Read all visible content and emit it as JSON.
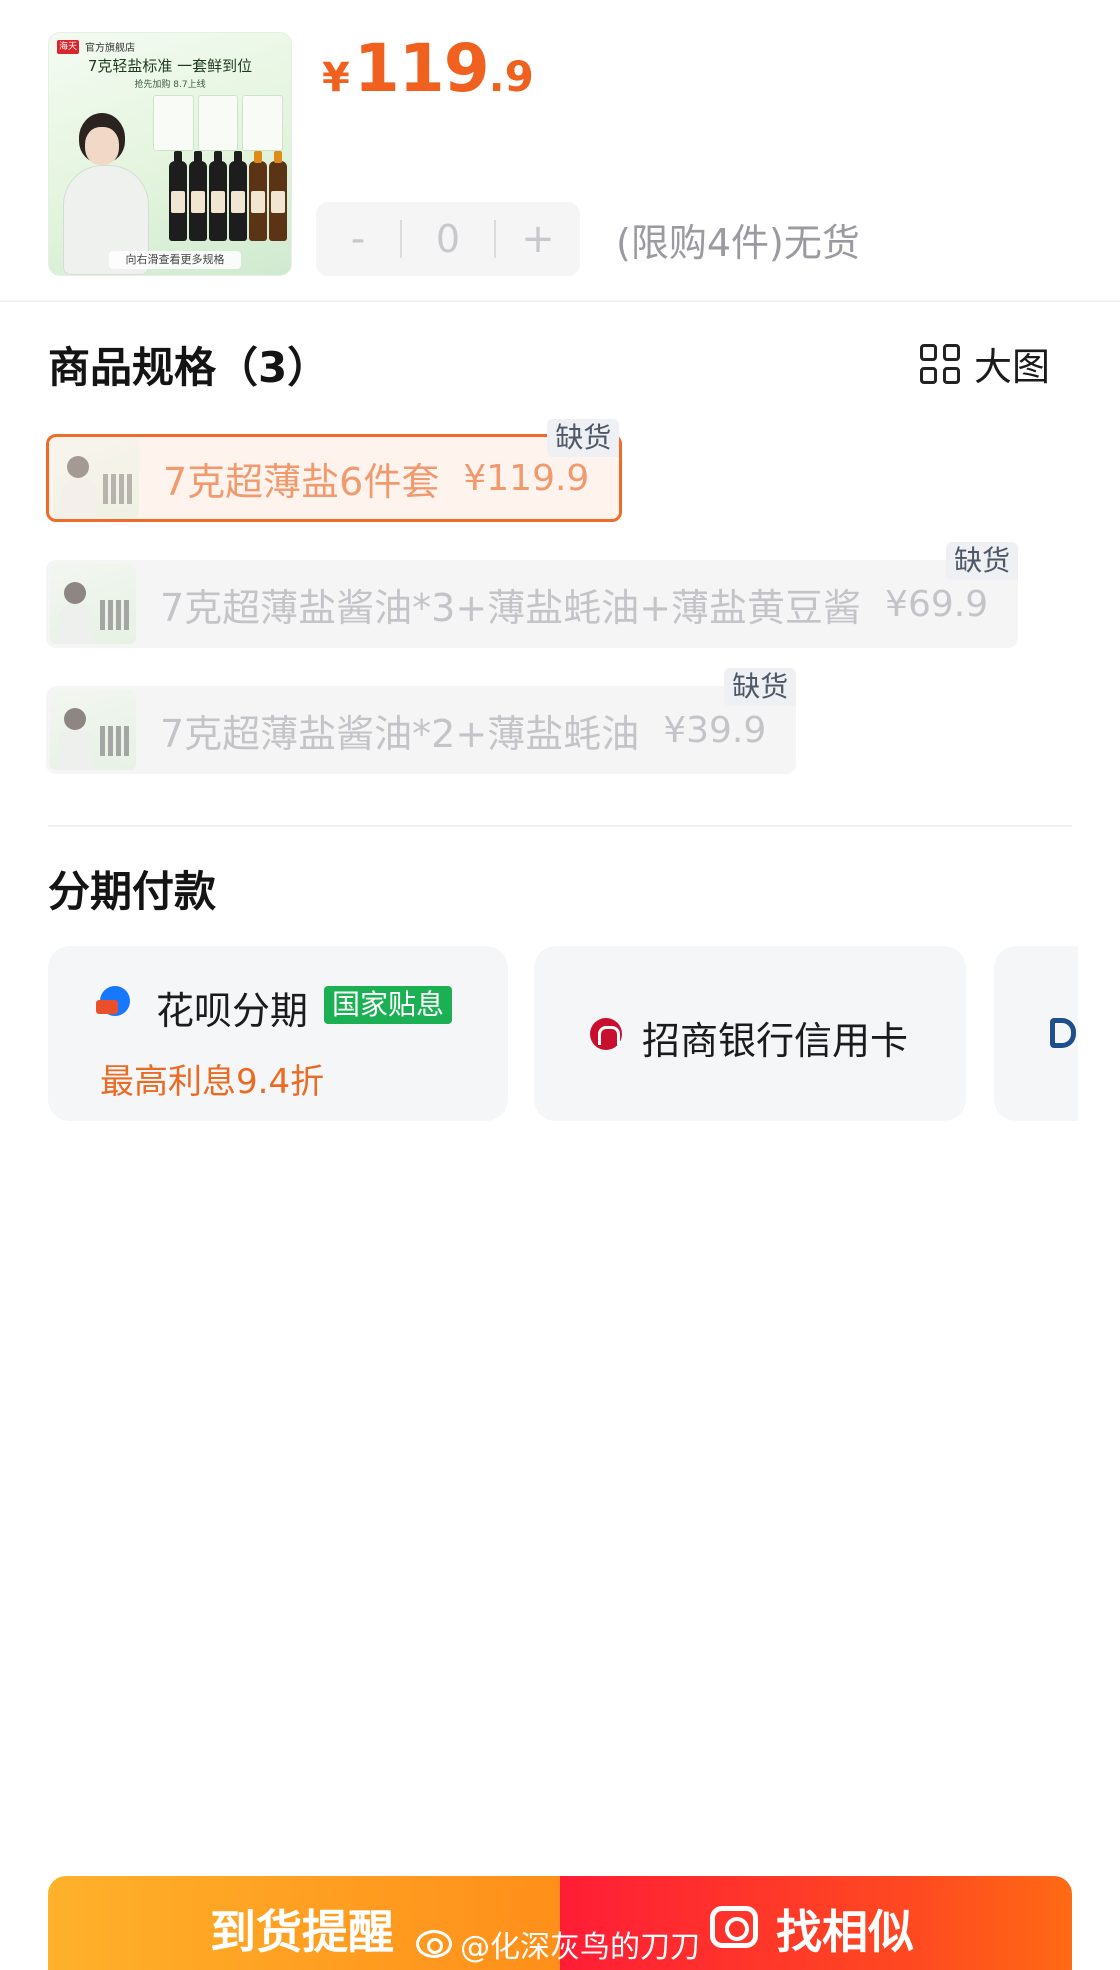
{
  "product": {
    "thumb": {
      "store_label": "官方旗舰店",
      "brand_mark": "海天",
      "headline": "7克轻盐标准 一套鲜到位",
      "sub": "抢先加购 8.7上线",
      "caption": "向右滑查看更多规格"
    },
    "price": {
      "currency": "¥",
      "integer": "119",
      "decimal": ".9",
      "color": "#f0601f"
    },
    "quantity": {
      "minus": "-",
      "value": "0",
      "plus": "+"
    },
    "stock_note": "(限购4件)无货"
  },
  "specs": {
    "title": "商品规格（3）",
    "big_view_label": "大图",
    "items": [
      {
        "name": "7克超薄盐6件套",
        "price": "¥119.9",
        "tag": "缺货",
        "selected": true
      },
      {
        "name": "7克超薄盐酱油*3+薄盐蚝油+薄盐黄豆酱",
        "price": "¥69.9",
        "tag": "缺货",
        "selected": false
      },
      {
        "name": "7克超薄盐酱油*2+薄盐蚝油",
        "price": "¥39.9",
        "tag": "缺货",
        "selected": false
      }
    ]
  },
  "installments": {
    "title": "分期付款",
    "options": [
      {
        "icon": "huabei-icon",
        "name": "花呗分期",
        "tag": "国家贴息",
        "sub": "最高利息9.4折"
      },
      {
        "icon": "cmb-bank-icon",
        "name": "招商银行信用卡"
      },
      {
        "icon": "bank-icon"
      }
    ]
  },
  "bottom_bar": {
    "left_label": "到货提醒",
    "right_label": "找相似",
    "watermark": "@化深灰鸟的刀刀"
  },
  "colors": {
    "accent": "#f0601f",
    "selected_border": "#f06a2a",
    "promo_green": "#1cb054",
    "remind_gradient": [
      "#ffb12a",
      "#ff8f1a"
    ],
    "similar_gradient": [
      "#ff1d36",
      "#ff6a14"
    ]
  }
}
